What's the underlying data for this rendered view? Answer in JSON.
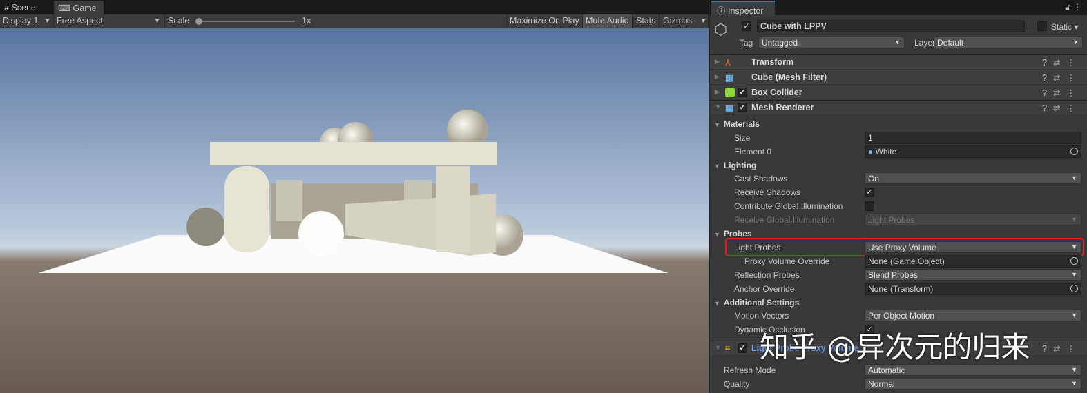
{
  "tabs": [
    {
      "label": "Scene",
      "icon": "grid-icon"
    },
    {
      "label": "Game",
      "icon": "gamepad-icon"
    }
  ],
  "toolbar": {
    "display": "Display 1",
    "aspect": "Free Aspect",
    "scale_label": "Scale",
    "scale_value": "1x",
    "maximize": "Maximize On Play",
    "mute": "Mute Audio",
    "stats": "Stats",
    "gizmos": "Gizmos"
  },
  "inspector": {
    "tab": "Inspector",
    "object_name": "Cube with LPPV",
    "active": true,
    "static_label": "Static",
    "tag_label": "Tag",
    "tag": "Untagged",
    "layer_label": "Layer",
    "layer": "Default",
    "components": [
      {
        "name": "Transform"
      },
      {
        "name": "Cube (Mesh Filter)"
      },
      {
        "name": "Box Collider",
        "enabled": true
      },
      {
        "name": "Mesh Renderer",
        "enabled": true
      },
      {
        "name": "Light Probe Proxy Volume",
        "enabled": true
      }
    ],
    "materials": {
      "header": "Materials",
      "size_label": "Size",
      "size": "1",
      "element0_label": "Element 0",
      "element0": "White"
    },
    "lighting": {
      "header": "Lighting",
      "cast_shadows_label": "Cast Shadows",
      "cast_shadows": "On",
      "receive_shadows_label": "Receive Shadows",
      "receive_shadows": true,
      "contribute_gi_label": "Contribute Global Illumination",
      "contribute_gi": false,
      "receive_gi_label": "Receive Global Illumination",
      "receive_gi": "Light Probes"
    },
    "probes": {
      "header": "Probes",
      "light_probes_label": "Light Probes",
      "light_probes": "Use Proxy Volume",
      "proxy_override_label": "Proxy Volume Override",
      "proxy_override": "None (Game Object)",
      "reflection_label": "Reflection Probes",
      "reflection": "Blend Probes",
      "anchor_label": "Anchor Override",
      "anchor": "None (Transform)"
    },
    "additional": {
      "header": "Additional Settings",
      "motion_label": "Motion Vectors",
      "motion": "Per Object Motion",
      "occlusion_label": "Dynamic Occlusion",
      "occlusion": true
    },
    "lppv": {
      "refresh_label": "Refresh Mode",
      "refresh": "Automatic",
      "quality_label": "Quality",
      "quality": "Normal"
    }
  },
  "highlight_color": "#e02020",
  "watermark": "知乎 @异次元的归来"
}
